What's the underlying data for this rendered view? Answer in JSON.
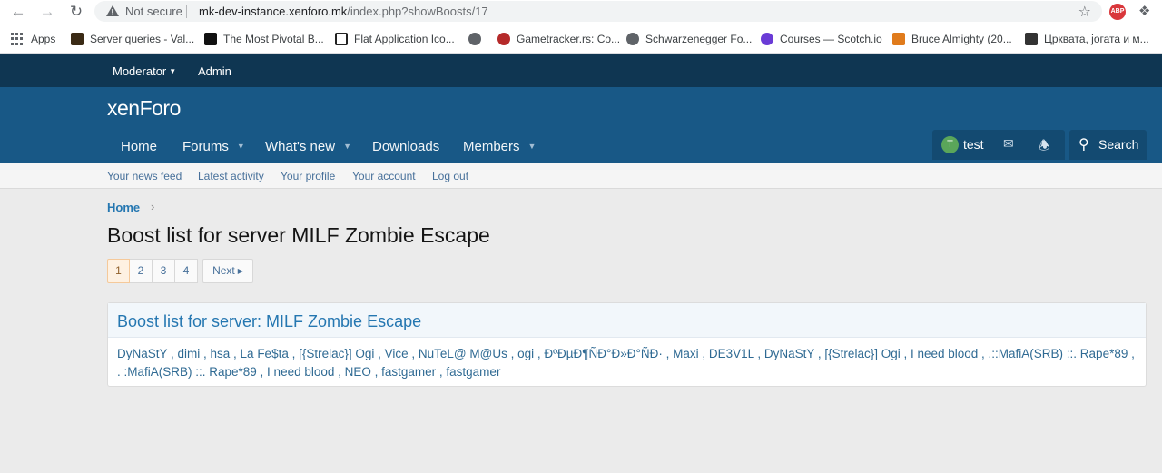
{
  "browser": {
    "back_icon": "arrow-left-icon",
    "forward_icon": "arrow-right-icon",
    "reload_icon": "reload-icon",
    "security_label": "Not secure",
    "url_host": "mk-dev-instance.xenforo.mk",
    "url_path": "/index.php?showBoosts/17",
    "abp_label": "ABP"
  },
  "bookmarks": [
    {
      "label": "Apps",
      "color": "#5f6368"
    },
    {
      "label": "Server queries - Val...",
      "color": "#3a2a15"
    },
    {
      "label": "The Most Pivotal B...",
      "color": "#111111"
    },
    {
      "label": "Flat Application Ico...",
      "color": "#222222"
    },
    {
      "label": "",
      "color": "#3c4043"
    },
    {
      "label": "Gametracker.rs: Co...",
      "color": "#b52a2a"
    },
    {
      "label": "Schwarzenegger Fo...",
      "color": "#3c4043"
    },
    {
      "label": "Courses — Scotch.io",
      "color": "#6a3bd6"
    },
    {
      "label": "Bruce Almighty (20...",
      "color": "#e07b1c"
    },
    {
      "label": "Црквата, јогата и м...",
      "color": "#333333"
    }
  ],
  "staffbar": {
    "moderator": "Moderator",
    "admin": "Admin"
  },
  "header": {
    "logo": "xenForo",
    "tabs": [
      {
        "label": "Home",
        "dropdown": false
      },
      {
        "label": "Forums",
        "dropdown": true
      },
      {
        "label": "What's new",
        "dropdown": true
      },
      {
        "label": "Downloads",
        "dropdown": false
      },
      {
        "label": "Members",
        "dropdown": true
      }
    ],
    "user_initial": "T",
    "username": "test",
    "search_label": "Search"
  },
  "subnav": [
    "Your news feed",
    "Latest activity",
    "Your profile",
    "Your account",
    "Log out"
  ],
  "breadcrumb": {
    "home": "Home",
    "arrow": "›"
  },
  "page_title": "Boost list for server MILF Zombie Escape",
  "pagination": {
    "pages": [
      "1",
      "2",
      "3",
      "4"
    ],
    "current": "1",
    "next_label": "Next"
  },
  "boost_block": {
    "title": "Boost list for server: MILF Zombie Escape",
    "body": "DyNaStY , dimi , hsa , La Fe$ta , [{Strelac}] Ogi , Vice , NuTeL@ M@Us , ogi , ĐºĐµĐ¶ÑĐ°Đ»Đ°ÑĐ· , Maxi , DE3V1L , DyNaStY , [{Strelac}] Ogi , I need blood , .::MafiA(SRB) ::. Rape*89 , . :MafiA(SRB) ::. Rape*89 , I need blood , NEO , fastgamer , fastgamer"
  },
  "colors": {
    "staffbar": "#0f3652",
    "header": "#185886",
    "link": "#2577b1"
  }
}
